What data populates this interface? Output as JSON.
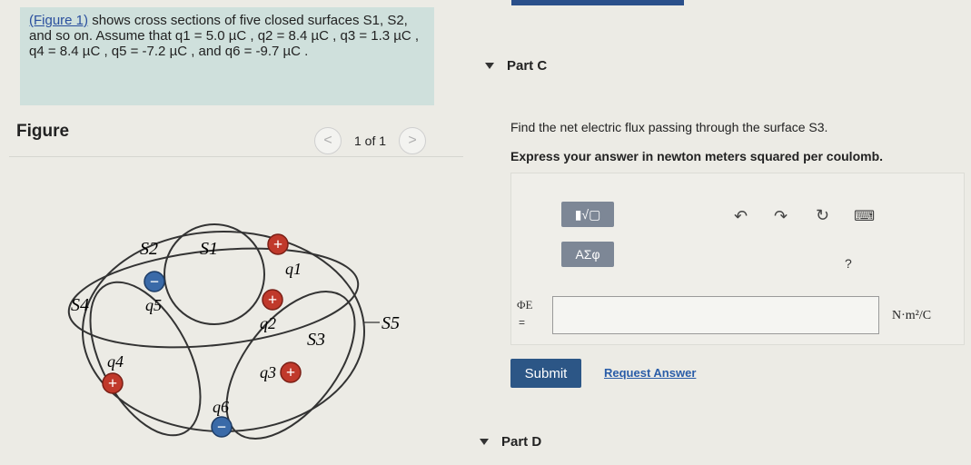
{
  "problem": {
    "figure_link": "(Figure 1)",
    "text": "shows cross sections of five closed surfaces S1, S2, and so on. Assume that q1 = 5.0 µC , q2 = 8.4 µC , q3 = 1.3 µC , q4 = 8.4 µC , q5 = -7.2 µC , and q6 = -9.7 µC ."
  },
  "figure": {
    "label": "Figure",
    "pager": {
      "prev": "<",
      "count": "1 of 1",
      "next": ">"
    },
    "surfaces": {
      "s1": "S1",
      "s2": "S2",
      "s3": "S3",
      "s4": "S4",
      "s5": "S5"
    },
    "charges": {
      "q1": {
        "label": "q1",
        "sign": "+"
      },
      "q2": {
        "label": "q2",
        "sign": "+"
      },
      "q3": {
        "label": "q3",
        "sign": "+"
      },
      "q4": {
        "label": "q4",
        "sign": "+"
      },
      "q5": {
        "label": "q5",
        "sign": "−"
      },
      "q6": {
        "label": "q6",
        "sign": "−"
      }
    },
    "colors": {
      "positive": "#c0392b",
      "negative": "#3a6aa8"
    }
  },
  "part_c": {
    "header": "Part C",
    "question": "Find the net electric flux passing through the surface S3.",
    "instruction": "Express your answer in newton meters squared per coulomb.",
    "toolbar": {
      "templates_icon": "▮√▢",
      "greek_label": "ΑΣφ",
      "help": "?"
    },
    "input": {
      "label": "ΦE",
      "eq": "=",
      "value": "",
      "units": "N·m²/C"
    },
    "submit_label": "Submit",
    "request_label": "Request Answer"
  },
  "part_d": {
    "header": "Part D"
  }
}
